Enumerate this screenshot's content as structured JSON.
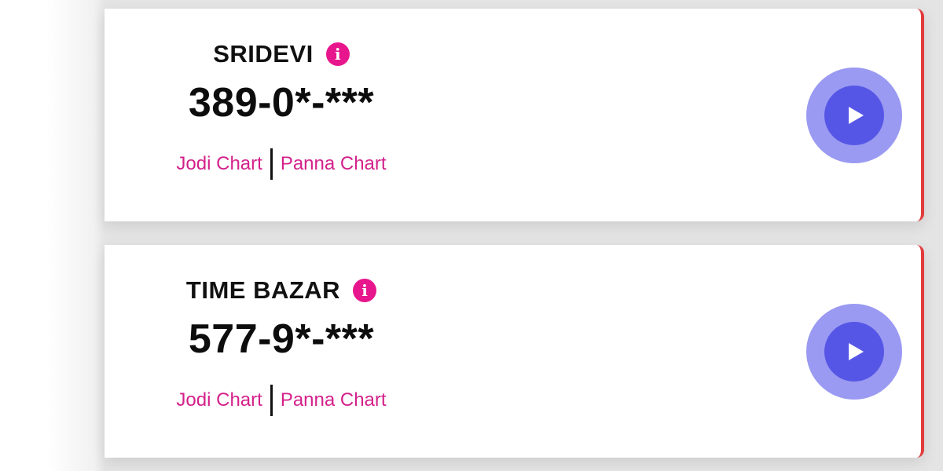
{
  "markets": [
    {
      "name": "SRIDEVI",
      "result": "389-0*-***",
      "jodi_label": "Jodi Chart",
      "panna_label": "Panna Chart",
      "info_glyph": "i"
    },
    {
      "name": "TIME BAZAR",
      "result": "577-9*-***",
      "jodi_label": "Jodi Chart",
      "panna_label": "Panna Chart",
      "info_glyph": "i"
    }
  ],
  "icons": {
    "info": "info-icon",
    "play": "play-icon"
  },
  "colors": {
    "accent_pink": "#e8168d",
    "link_pink": "#d4218a",
    "card_border_red": "#e23b3b",
    "play_outer": "#9a9af2",
    "play_inner": "#5656e6"
  }
}
